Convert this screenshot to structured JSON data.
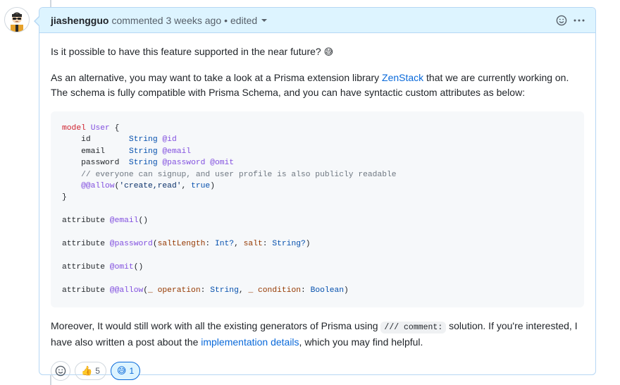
{
  "comment": {
    "author": "jiashengguo",
    "action": "commented",
    "time": "3 weeks ago",
    "separator": "•",
    "edited_label": "edited",
    "question": "Is it possible to have this feature supported in the near future?",
    "question_emoji": "😅",
    "para2_before": "As an alternative, you may want to take a look at a Prisma extension library ",
    "para2_link": "ZenStack",
    "para2_after": " that we are currently working on. The schema is fully compatible with Prisma Schema, and you can have syntactic custom attributes as below:",
    "para3_before": "Moreover, It would still work with all the existing generators of Prisma using ",
    "para3_code": "/// comment:",
    "para3_middle": " solution. If you're interested, I have also written a post about the ",
    "para3_link": "implementation details",
    "para3_after": ", which you may find helpful."
  },
  "code": {
    "model_kw": "model",
    "model_name": "User",
    "open_brace": " {",
    "close_brace": "}",
    "fields": [
      {
        "name": "id",
        "pad": "        ",
        "type": "String",
        "attrs": " @id"
      },
      {
        "name": "email",
        "pad": "     ",
        "type": "String",
        "attrs": " @email"
      },
      {
        "name": "password",
        "pad": "  ",
        "type": "String",
        "attrs": " @password @omit"
      }
    ],
    "comment_line": "// everyone can signup, and user profile is also publicly readable",
    "allow_name": "@@allow",
    "allow_open": "(",
    "allow_str": "'create,read'",
    "allow_sep": ", ",
    "allow_bool": "true",
    "allow_close": ")",
    "attr_kw": "attribute",
    "attr1_name": "@email",
    "attr1_args": "()",
    "attr2_name": "@password",
    "attr2_p1": "saltLength",
    "attr2_t1": "Int?",
    "attr2_p2": "salt",
    "attr2_t2": "String?",
    "attr3_name": "@omit",
    "attr3_args": "()",
    "attr4_name": "@@allow",
    "attr4_p1": "_ operation",
    "attr4_t1": "String",
    "attr4_p2": "_ condition",
    "attr4_t2": "Boolean"
  },
  "reactions": {
    "thumbs_emoji": "👍",
    "thumbs_count": "5",
    "smile_emoji": "😅",
    "smile_count": "1"
  },
  "icons": {
    "smiley": "smiley-icon",
    "kebab": "kebab-horizontal-icon",
    "caret": "triangle-down-icon"
  },
  "colors": {
    "header_bg": "#ddf4ff",
    "border": "#b6d7f4",
    "link": "#0969da",
    "code_bg": "#f6f8fa"
  }
}
